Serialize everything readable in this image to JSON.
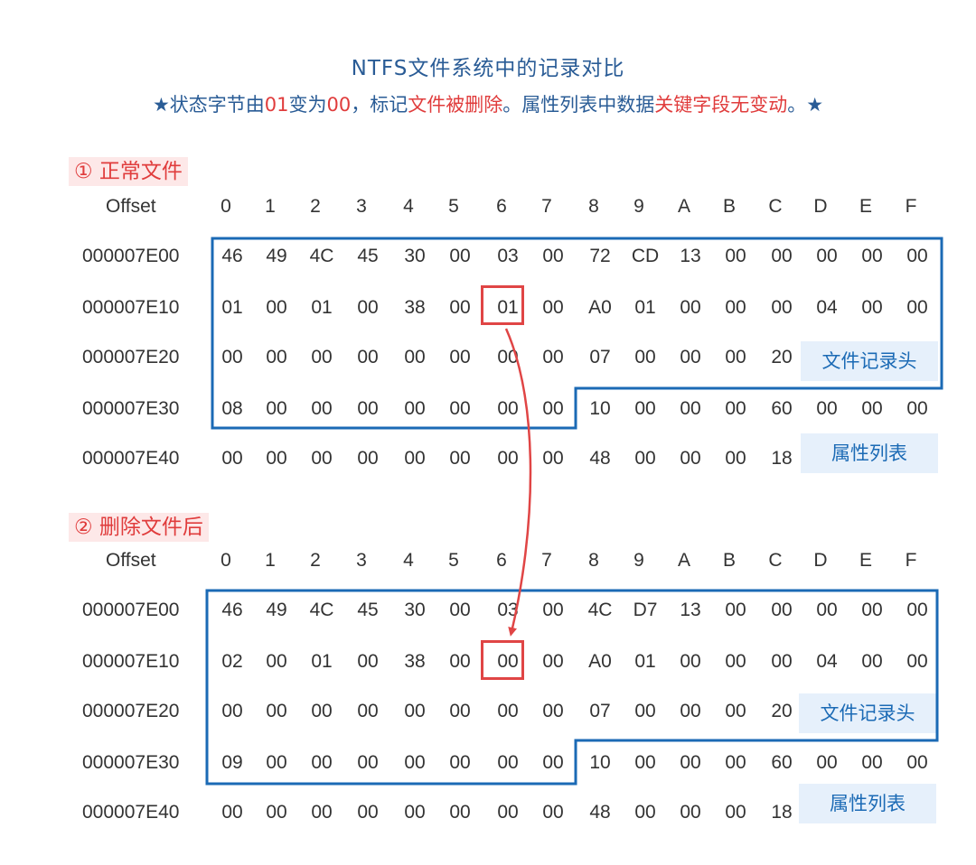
{
  "title": "NTFS文件系统中的记录对比",
  "subtitle": {
    "star_left": "★",
    "part1": "状态字节由",
    "val_before": "01",
    "part2": "变为",
    "val_after": "00",
    "part3": "，标记",
    "highlight1": "文件被删除",
    "part4": "。属性列表中数据",
    "highlight2": "关键字段无变动",
    "part5": "。",
    "star_right": "★"
  },
  "columns": [
    "0",
    "1",
    "2",
    "3",
    "4",
    "5",
    "6",
    "7",
    "8",
    "9",
    "A",
    "B",
    "C",
    "D",
    "E",
    "F"
  ],
  "offset_header": "Offset",
  "tags": {
    "record_header": "文件记录头",
    "attribute_list": "属性列表"
  },
  "colors": {
    "accent_blue": "#1b6ab5",
    "accent_red": "#e03c3c",
    "tag_bg": "#e6f0fb",
    "label_bg": "#fde8e8"
  },
  "sections": [
    {
      "label": "① 正常文件",
      "rows": [
        {
          "offset": "000007E00",
          "bytes": [
            "46",
            "49",
            "4C",
            "45",
            "30",
            "00",
            "03",
            "00",
            "72",
            "CD",
            "13",
            "00",
            "00",
            "00",
            "00",
            "00"
          ]
        },
        {
          "offset": "000007E10",
          "bytes": [
            "01",
            "00",
            "01",
            "00",
            "38",
            "00",
            "01",
            "00",
            "A0",
            "01",
            "00",
            "00",
            "00",
            "04",
            "00",
            "00"
          ]
        },
        {
          "offset": "000007E20",
          "bytes": [
            "00",
            "00",
            "00",
            "00",
            "00",
            "00",
            "00",
            "00",
            "07",
            "00",
            "00",
            "00",
            "20",
            "",
            "",
            ""
          ]
        },
        {
          "offset": "000007E30",
          "bytes": [
            "08",
            "00",
            "00",
            "00",
            "00",
            "00",
            "00",
            "00",
            "10",
            "00",
            "00",
            "00",
            "60",
            "00",
            "00",
            "00"
          ]
        },
        {
          "offset": "000007E40",
          "bytes": [
            "00",
            "00",
            "00",
            "00",
            "00",
            "00",
            "00",
            "00",
            "48",
            "00",
            "00",
            "00",
            "18",
            "",
            "",
            ""
          ]
        }
      ]
    },
    {
      "label": "② 删除文件后",
      "rows": [
        {
          "offset": "000007E00",
          "bytes": [
            "46",
            "49",
            "4C",
            "45",
            "30",
            "00",
            "03",
            "00",
            "4C",
            "D7",
            "13",
            "00",
            "00",
            "00",
            "00",
            "00"
          ]
        },
        {
          "offset": "000007E10",
          "bytes": [
            "02",
            "00",
            "01",
            "00",
            "38",
            "00",
            "00",
            "00",
            "A0",
            "01",
            "00",
            "00",
            "00",
            "04",
            "00",
            "00"
          ]
        },
        {
          "offset": "000007E20",
          "bytes": [
            "00",
            "00",
            "00",
            "00",
            "00",
            "00",
            "00",
            "00",
            "07",
            "00",
            "00",
            "00",
            "20",
            "",
            "",
            ""
          ]
        },
        {
          "offset": "000007E30",
          "bytes": [
            "09",
            "00",
            "00",
            "00",
            "00",
            "00",
            "00",
            "00",
            "10",
            "00",
            "00",
            "00",
            "60",
            "00",
            "00",
            "00"
          ]
        },
        {
          "offset": "000007E40",
          "bytes": [
            "00",
            "00",
            "00",
            "00",
            "00",
            "00",
            "00",
            "00",
            "48",
            "00",
            "00",
            "00",
            "18",
            "",
            "",
            ""
          ]
        }
      ]
    }
  ]
}
